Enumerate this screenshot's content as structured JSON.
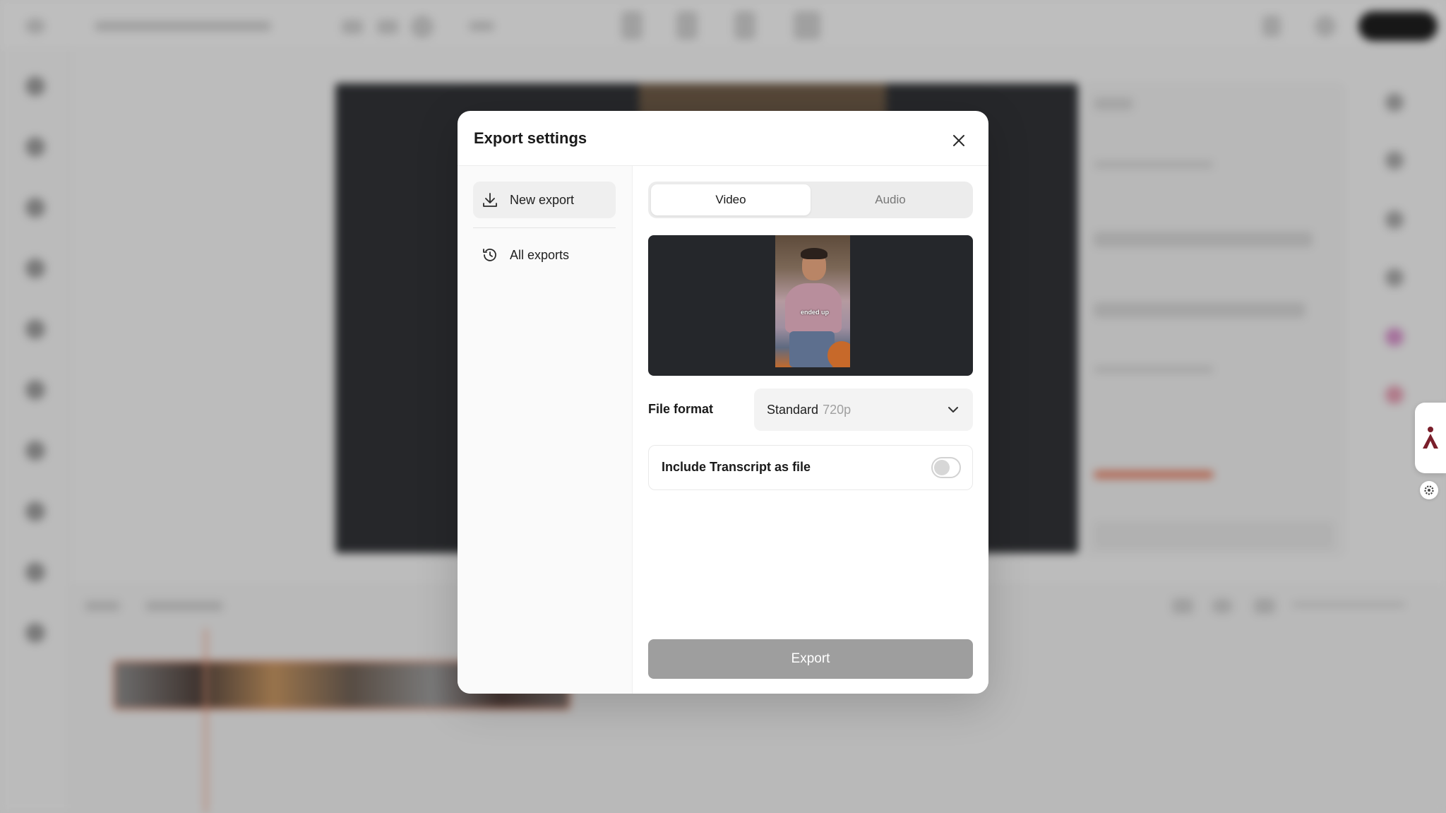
{
  "modal": {
    "title": "Export settings",
    "nav": [
      {
        "label": "New export",
        "icon": "download-icon",
        "active": true
      },
      {
        "label": "All exports",
        "icon": "history-icon",
        "active": false
      }
    ],
    "tabs": [
      {
        "label": "Video",
        "active": true
      },
      {
        "label": "Audio",
        "active": false
      }
    ],
    "file_format": {
      "label": "File format",
      "value": "Standard",
      "resolution": "720p"
    },
    "include_transcript": {
      "label": "Include Transcript as file",
      "enabled": false
    },
    "export_label": "Export"
  },
  "preview": {
    "caption": "ended up"
  },
  "colors": {
    "accent": "#f0916f",
    "export_disabled": "#9e9e9e",
    "preview_bg": "#25272b"
  }
}
